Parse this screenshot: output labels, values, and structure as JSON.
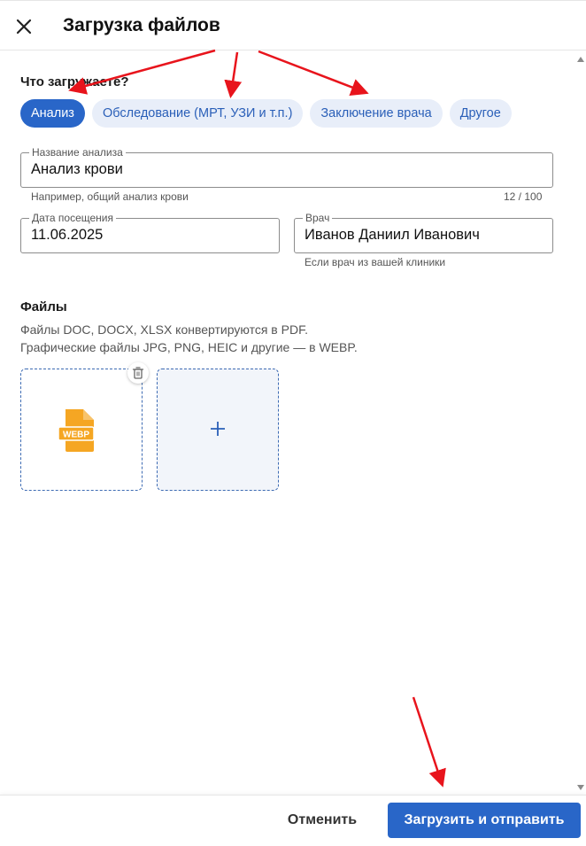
{
  "header": {
    "title": "Загрузка файлов",
    "close_icon": "close-icon"
  },
  "type_section": {
    "label": "Что загружаете?",
    "chips": [
      {
        "label": "Анализ",
        "active": true
      },
      {
        "label": "Обследование (МРТ, УЗИ и т.п.)",
        "active": false
      },
      {
        "label": "Заключение врача",
        "active": false
      },
      {
        "label": "Другое",
        "active": false
      }
    ]
  },
  "form": {
    "analysis_name": {
      "label": "Название анализа",
      "value": "Анализ крови",
      "hint": "Например, общий анализ крови",
      "counter": "12 / 100"
    },
    "visit_date": {
      "label": "Дата посещения",
      "value": "11.06.2025"
    },
    "doctor": {
      "label": "Врач",
      "value": "Иванов Даниил Иванович",
      "hint": "Если врач из вашей клиники"
    }
  },
  "files": {
    "title": "Файлы",
    "desc_line1": "Файлы DOC, DOCX, XLSX конвертируются в PDF.",
    "desc_line2": "Графические файлы JPG, PNG, HEIC и другие — в WEBP.",
    "items": [
      {
        "type_label": "WEBP",
        "icon": "webp-file-icon"
      }
    ],
    "add_icon": "plus-icon"
  },
  "footer": {
    "cancel_label": "Отменить",
    "submit_label": "Загрузить и отправить"
  },
  "colors": {
    "accent": "#2966c8",
    "chip_bg": "#e8eef9",
    "file_icon": "#f5a623",
    "annotation_arrow": "#e8141c"
  }
}
